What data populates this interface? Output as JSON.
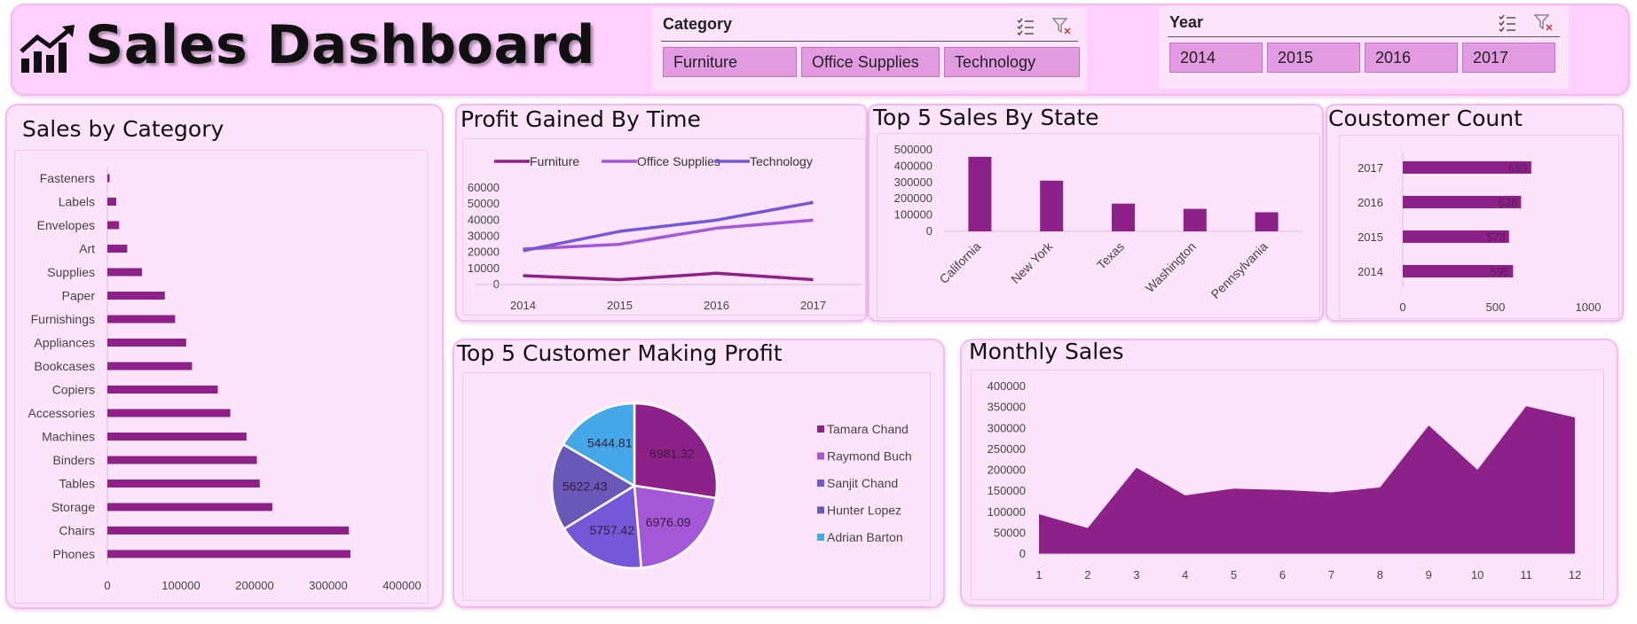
{
  "header": {
    "title": "Sales Dashboard"
  },
  "colors": {
    "accent": "#8e2189",
    "panel_bg": "#fde4fb",
    "slicer_btn": "#e29ae1"
  },
  "slicers": {
    "category": {
      "title": "Category",
      "items": [
        "Furniture",
        "Office Supplies",
        "Technology"
      ]
    },
    "year": {
      "title": "Year",
      "items": [
        "2014",
        "2015",
        "2016",
        "2017"
      ]
    }
  },
  "panels": {
    "sales_by_category": "Sales by Category",
    "profit_by_time": "Profit Gained By Time",
    "top5_state": "Top 5 Sales By State",
    "customer_count": "Coustomer Count",
    "top5_customer": "Top 5 Customer Making Profit",
    "monthly_sales": "Monthly Sales"
  },
  "chart_data": [
    {
      "id": "sales_by_category",
      "type": "bar",
      "orientation": "horizontal",
      "categories": [
        "Fasteners",
        "Labels",
        "Envelopes",
        "Art",
        "Supplies",
        "Paper",
        "Furnishings",
        "Appliances",
        "Bookcases",
        "Copiers",
        "Accessories",
        "Machines",
        "Binders",
        "Tables",
        "Storage",
        "Chairs",
        "Phones"
      ],
      "values": [
        3000,
        12000,
        16000,
        27000,
        47000,
        78000,
        92000,
        107000,
        115000,
        150000,
        167000,
        189000,
        203000,
        207000,
        224000,
        328000,
        330000
      ],
      "xticks": [
        "0",
        "100000",
        "200000",
        "300000",
        "400000"
      ],
      "xlim": [
        0,
        400000
      ],
      "color": "#8e2189"
    },
    {
      "id": "profit_by_time",
      "type": "line",
      "x": [
        "2014",
        "2015",
        "2016",
        "2017"
      ],
      "yticks": [
        "0",
        "10000",
        "20000",
        "30000",
        "40000",
        "50000",
        "60000"
      ],
      "ylim": [
        0,
        60000
      ],
      "legend": "top",
      "series": [
        {
          "name": "Furniture",
          "values": [
            5500,
            3000,
            7000,
            3000
          ],
          "color": "#8e2189"
        },
        {
          "name": "Office Supplies",
          "values": [
            22000,
            25000,
            35000,
            40000
          ],
          "color": "#a458d8"
        },
        {
          "name": "Technology",
          "values": [
            21000,
            33000,
            40000,
            51000
          ],
          "color": "#7458d8"
        }
      ]
    },
    {
      "id": "top5_state",
      "type": "bar",
      "categories": [
        "California",
        "New York",
        "Texas",
        "Washington",
        "Pennsylvania"
      ],
      "values": [
        457000,
        311000,
        170000,
        138000,
        117000
      ],
      "yticks": [
        "0",
        "100000",
        "200000",
        "300000",
        "400000",
        "500000"
      ],
      "ylim": [
        0,
        500000
      ],
      "color": "#8e2189"
    },
    {
      "id": "customer_count",
      "type": "bar",
      "orientation": "horizontal",
      "categories": [
        "2017",
        "2016",
        "2015",
        "2014"
      ],
      "values": [
        693,
        638,
        573,
        595
      ],
      "labels": [
        "693",
        "638",
        "573",
        "595"
      ],
      "xticks": [
        "0",
        "500",
        "1000"
      ],
      "xlim": [
        0,
        1000
      ],
      "color": "#8e2189"
    },
    {
      "id": "top5_customer",
      "type": "pie",
      "legend": "right",
      "slices": [
        {
          "name": "Tamara Chand",
          "value": 8981.32,
          "label": "8981.32",
          "color": "#8e2189"
        },
        {
          "name": "Raymond Buch",
          "value": 6976.09,
          "label": "6976.09",
          "color": "#a458d8"
        },
        {
          "name": "Sanjit Chand",
          "value": 5757.42,
          "label": "5757.42",
          "color": "#7458d8"
        },
        {
          "name": "Hunter Lopez",
          "value": 5622.43,
          "label": "5622.43",
          "color": "#6a58b8"
        },
        {
          "name": "Adrian Barton",
          "value": 5444.81,
          "label": "5444.81",
          "color": "#44a8e8"
        }
      ]
    },
    {
      "id": "monthly_sales",
      "type": "area",
      "x": [
        "1",
        "2",
        "3",
        "4",
        "5",
        "6",
        "7",
        "8",
        "9",
        "10",
        "11",
        "12"
      ],
      "values": [
        95000,
        62000,
        206000,
        140000,
        156000,
        153000,
        147000,
        159000,
        307000,
        201000,
        353000,
        326000
      ],
      "yticks": [
        "0",
        "50000",
        "100000",
        "150000",
        "200000",
        "250000",
        "300000",
        "350000",
        "400000"
      ],
      "ylim": [
        0,
        400000
      ],
      "color": "#8e2189"
    }
  ]
}
